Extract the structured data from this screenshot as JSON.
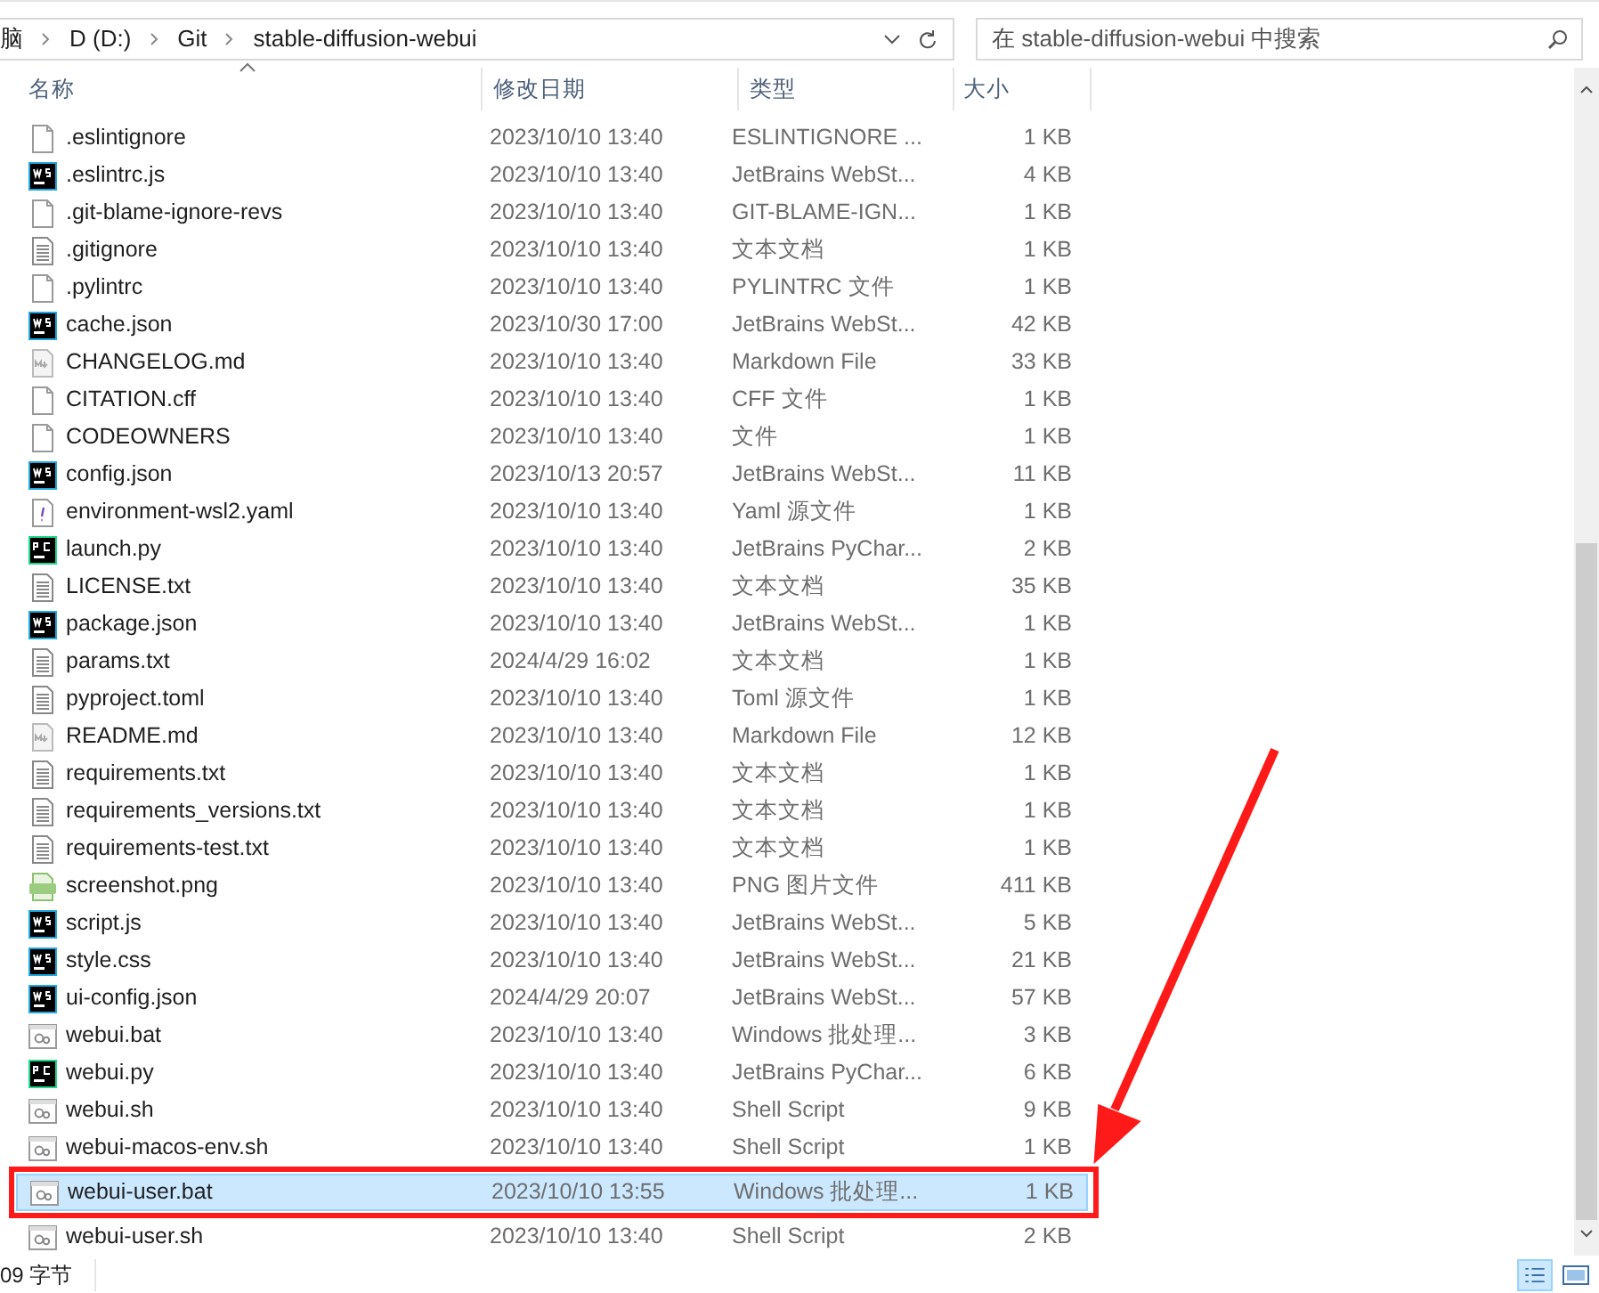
{
  "breadcrumb": [
    "脑",
    "D (D:)",
    "Git",
    "stable-diffusion-webui"
  ],
  "search": {
    "placeholder": "在 stable-diffusion-webui 中搜索"
  },
  "columns": [
    "名称",
    "修改日期",
    "类型",
    "大小"
  ],
  "files": [
    {
      "name": ".eslintignore",
      "date": "2023/10/10 13:40",
      "type": "ESLINTIGNORE ...",
      "size": "1 KB",
      "kind": "blank",
      "selected": false
    },
    {
      "name": ".eslintrc.js",
      "date": "2023/10/10 13:40",
      "type": "JetBrains WebSt...",
      "size": "4 KB",
      "kind": "ws",
      "selected": false
    },
    {
      "name": ".git-blame-ignore-revs",
      "date": "2023/10/10 13:40",
      "type": "GIT-BLAME-IGN...",
      "size": "1 KB",
      "kind": "blank",
      "selected": false
    },
    {
      "name": ".gitignore",
      "date": "2023/10/10 13:40",
      "type": "文本文档",
      "size": "1 KB",
      "kind": "text",
      "selected": false
    },
    {
      "name": ".pylintrc",
      "date": "2023/10/10 13:40",
      "type": "PYLINTRC 文件",
      "size": "1 KB",
      "kind": "blank",
      "selected": false
    },
    {
      "name": "cache.json",
      "date": "2023/10/30 17:00",
      "type": "JetBrains WebSt...",
      "size": "42 KB",
      "kind": "ws",
      "selected": false
    },
    {
      "name": "CHANGELOG.md",
      "date": "2023/10/10 13:40",
      "type": "Markdown File",
      "size": "33 KB",
      "kind": "md",
      "selected": false
    },
    {
      "name": "CITATION.cff",
      "date": "2023/10/10 13:40",
      "type": "CFF 文件",
      "size": "1 KB",
      "kind": "blank",
      "selected": false
    },
    {
      "name": "CODEOWNERS",
      "date": "2023/10/10 13:40",
      "type": "文件",
      "size": "1 KB",
      "kind": "blank",
      "selected": false
    },
    {
      "name": "config.json",
      "date": "2023/10/13 20:57",
      "type": "JetBrains WebSt...",
      "size": "11 KB",
      "kind": "ws",
      "selected": false
    },
    {
      "name": "environment-wsl2.yaml",
      "date": "2023/10/10 13:40",
      "type": "Yaml 源文件",
      "size": "1 KB",
      "kind": "yaml",
      "selected": false
    },
    {
      "name": "launch.py",
      "date": "2023/10/10 13:40",
      "type": "JetBrains PyChar...",
      "size": "2 KB",
      "kind": "pc",
      "selected": false
    },
    {
      "name": "LICENSE.txt",
      "date": "2023/10/10 13:40",
      "type": "文本文档",
      "size": "35 KB",
      "kind": "text",
      "selected": false
    },
    {
      "name": "package.json",
      "date": "2023/10/10 13:40",
      "type": "JetBrains WebSt...",
      "size": "1 KB",
      "kind": "ws",
      "selected": false
    },
    {
      "name": "params.txt",
      "date": "2024/4/29 16:02",
      "type": "文本文档",
      "size": "1 KB",
      "kind": "text",
      "selected": false
    },
    {
      "name": "pyproject.toml",
      "date": "2023/10/10 13:40",
      "type": "Toml 源文件",
      "size": "1 KB",
      "kind": "text",
      "selected": false
    },
    {
      "name": "README.md",
      "date": "2023/10/10 13:40",
      "type": "Markdown File",
      "size": "12 KB",
      "kind": "md",
      "selected": false
    },
    {
      "name": "requirements.txt",
      "date": "2023/10/10 13:40",
      "type": "文本文档",
      "size": "1 KB",
      "kind": "text",
      "selected": false
    },
    {
      "name": "requirements_versions.txt",
      "date": "2023/10/10 13:40",
      "type": "文本文档",
      "size": "1 KB",
      "kind": "text",
      "selected": false
    },
    {
      "name": "requirements-test.txt",
      "date": "2023/10/10 13:40",
      "type": "文本文档",
      "size": "1 KB",
      "kind": "text",
      "selected": false
    },
    {
      "name": "screenshot.png",
      "date": "2023/10/10 13:40",
      "type": "PNG 图片文件",
      "size": "411 KB",
      "kind": "png",
      "selected": false
    },
    {
      "name": "script.js",
      "date": "2023/10/10 13:40",
      "type": "JetBrains WebSt...",
      "size": "5 KB",
      "kind": "ws",
      "selected": false
    },
    {
      "name": "style.css",
      "date": "2023/10/10 13:40",
      "type": "JetBrains WebSt...",
      "size": "21 KB",
      "kind": "ws",
      "selected": false
    },
    {
      "name": "ui-config.json",
      "date": "2024/4/29 20:07",
      "type": "JetBrains WebSt...",
      "size": "57 KB",
      "kind": "ws",
      "selected": false
    },
    {
      "name": "webui.bat",
      "date": "2023/10/10 13:40",
      "type": "Windows 批处理...",
      "size": "3 KB",
      "kind": "bat",
      "selected": false
    },
    {
      "name": "webui.py",
      "date": "2023/10/10 13:40",
      "type": "JetBrains PyChar...",
      "size": "6 KB",
      "kind": "pc",
      "selected": false
    },
    {
      "name": "webui.sh",
      "date": "2023/10/10 13:40",
      "type": "Shell Script",
      "size": "9 KB",
      "kind": "bat",
      "selected": false
    },
    {
      "name": "webui-macos-env.sh",
      "date": "2023/10/10 13:40",
      "type": "Shell Script",
      "size": "1 KB",
      "kind": "bat",
      "selected": false
    },
    {
      "name": "webui-user.bat",
      "date": "2023/10/10 13:55",
      "type": "Windows 批处理...",
      "size": "1 KB",
      "kind": "bat",
      "selected": true
    },
    {
      "name": "webui-user.sh",
      "date": "2023/10/10 13:40",
      "type": "Shell Script",
      "size": "2 KB",
      "kind": "bat",
      "selected": false
    }
  ],
  "status_bar": {
    "text": "09 字节"
  }
}
